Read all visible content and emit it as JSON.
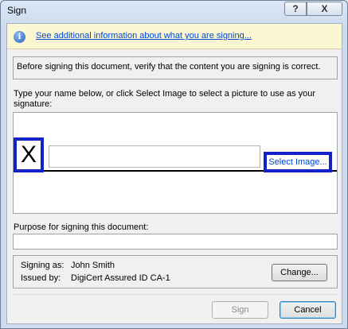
{
  "window": {
    "title": "Sign",
    "help_label": "?",
    "close_label": "X"
  },
  "info_bar": {
    "icon": "info-icon",
    "icon_glyph": "i",
    "link_text": "See additional information about what you are signing..."
  },
  "verify_text": "Before signing this document, verify that the content you are signing is correct.",
  "instructions": "Type your name below, or click Select Image to select a picture to use as your signature:",
  "signature": {
    "x_mark": "X",
    "name_value": "",
    "select_image_label": "Select Image..."
  },
  "purpose": {
    "label": "Purpose for signing this document:",
    "value": ""
  },
  "certificate": {
    "signing_as_label": "Signing as:",
    "signing_as_value": "John Smith",
    "issued_by_label": "Issued by:",
    "issued_by_value": "DigiCert Assured ID CA-1",
    "change_label": "Change..."
  },
  "buttons": {
    "sign_label": "Sign",
    "cancel_label": "Cancel"
  }
}
